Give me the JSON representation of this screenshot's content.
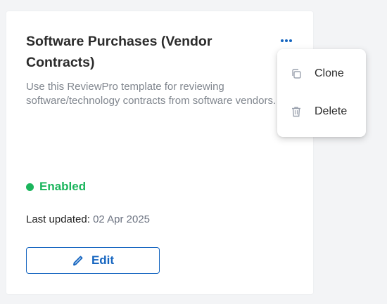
{
  "card": {
    "title": "Software Purchases (Vendor Contracts)",
    "description": "Use this ReviewPro template for reviewing\nsoftware/technology contracts from software vendors.",
    "status": {
      "label": "Enabled",
      "color": "#1bb55c"
    },
    "last_updated": {
      "label": "Last updated:",
      "value": "02 Apr 2025"
    },
    "edit_button": {
      "label": "Edit",
      "icon": "pencil-icon"
    },
    "more_menu_icon": "ellipsis-icon"
  },
  "context_menu": {
    "items": [
      {
        "label": "Clone",
        "icon": "copy-icon"
      },
      {
        "label": "Delete",
        "icon": "trash-icon"
      }
    ]
  },
  "colors": {
    "accent": "#1565c0",
    "muted_text": "#80868e"
  }
}
